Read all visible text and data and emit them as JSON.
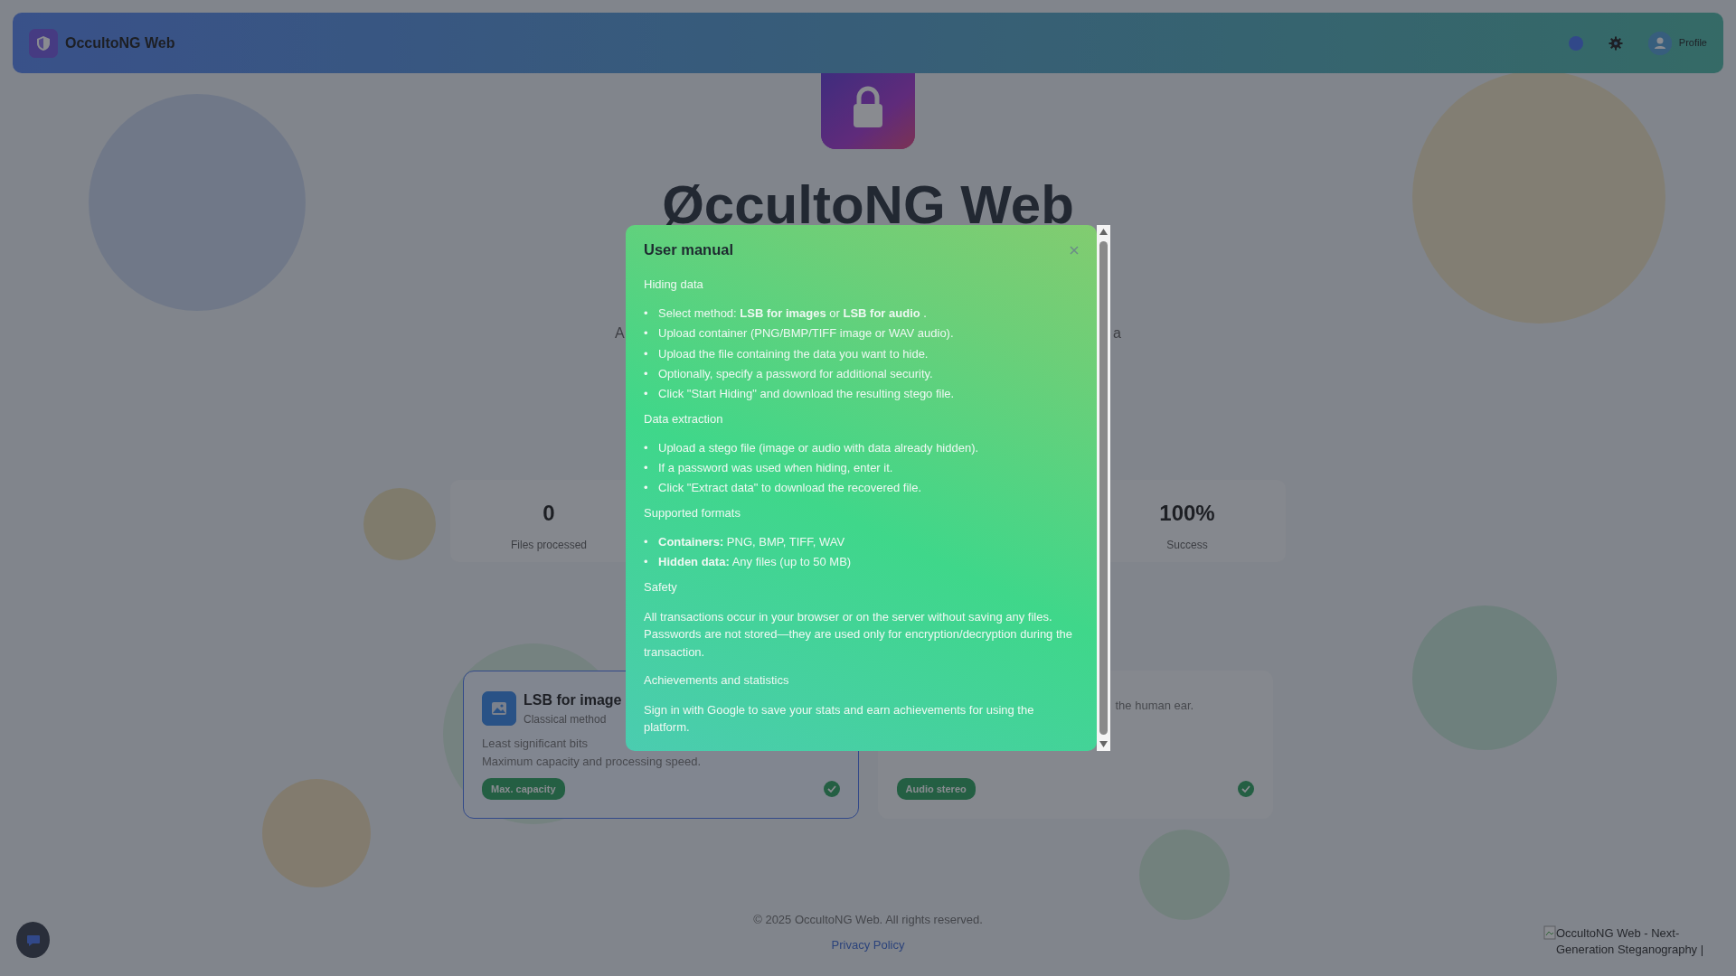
{
  "header": {
    "title": "OccultoNG Web",
    "profile_label": "Profile"
  },
  "hero": {
    "title": "ØccultoNG Web",
    "subtitle_fragments": [
      "A",
      "a"
    ]
  },
  "stats": [
    {
      "value": "0",
      "label": "Files processed"
    },
    {
      "value": "100%",
      "label": "Success"
    }
  ],
  "methods": [
    {
      "title": "LSB for image",
      "subtitle": "Classical method",
      "description": [
        "Least significant bits",
        "Maximum capacity and processing speed."
      ],
      "badge": "Max. capacity",
      "selected": true
    },
    {
      "description": [
        "the human ear."
      ],
      "badge": "Audio stereo",
      "selected": false
    }
  ],
  "modal": {
    "title": "User manual",
    "bullet": "•",
    "sections": [
      {
        "heading": "Hiding data",
        "items": [
          "Select method: **LSB for images** or **LSB for audio** .",
          "Upload container (PNG/BMP/TIFF image or WAV audio).",
          "Upload the file containing the data you want to hide.",
          "Optionally, specify a password for additional security.",
          "Click \"Start Hiding\" and download the resulting stego file."
        ]
      },
      {
        "heading": "Data extraction",
        "items": [
          "Upload a stego file (image or audio with data already hidden).",
          "If a password was used when hiding, enter it.",
          "Click \"Extract data\" to download the recovered file."
        ]
      },
      {
        "heading": "Supported formats",
        "items": [
          "**Containers:** PNG, BMP, TIFF, WAV",
          "**Hidden data:** Any files (up to 50 MB)"
        ]
      },
      {
        "heading": "Safety",
        "paragraph": "All transactions occur in your browser or on the server without saving any files. Passwords are not stored—they are used only for encryption/decryption during the transaction."
      },
      {
        "heading": "Achievements and statistics",
        "paragraph": "Sign in with Google to save your stats and earn achievements for using the platform."
      }
    ]
  },
  "footer": {
    "copyright": "© 2025 OccultoNG Web. All rights reserved.",
    "link": "Privacy Policy",
    "image_alt": "OccultoNG Web - Next-Generation Steganography |"
  }
}
